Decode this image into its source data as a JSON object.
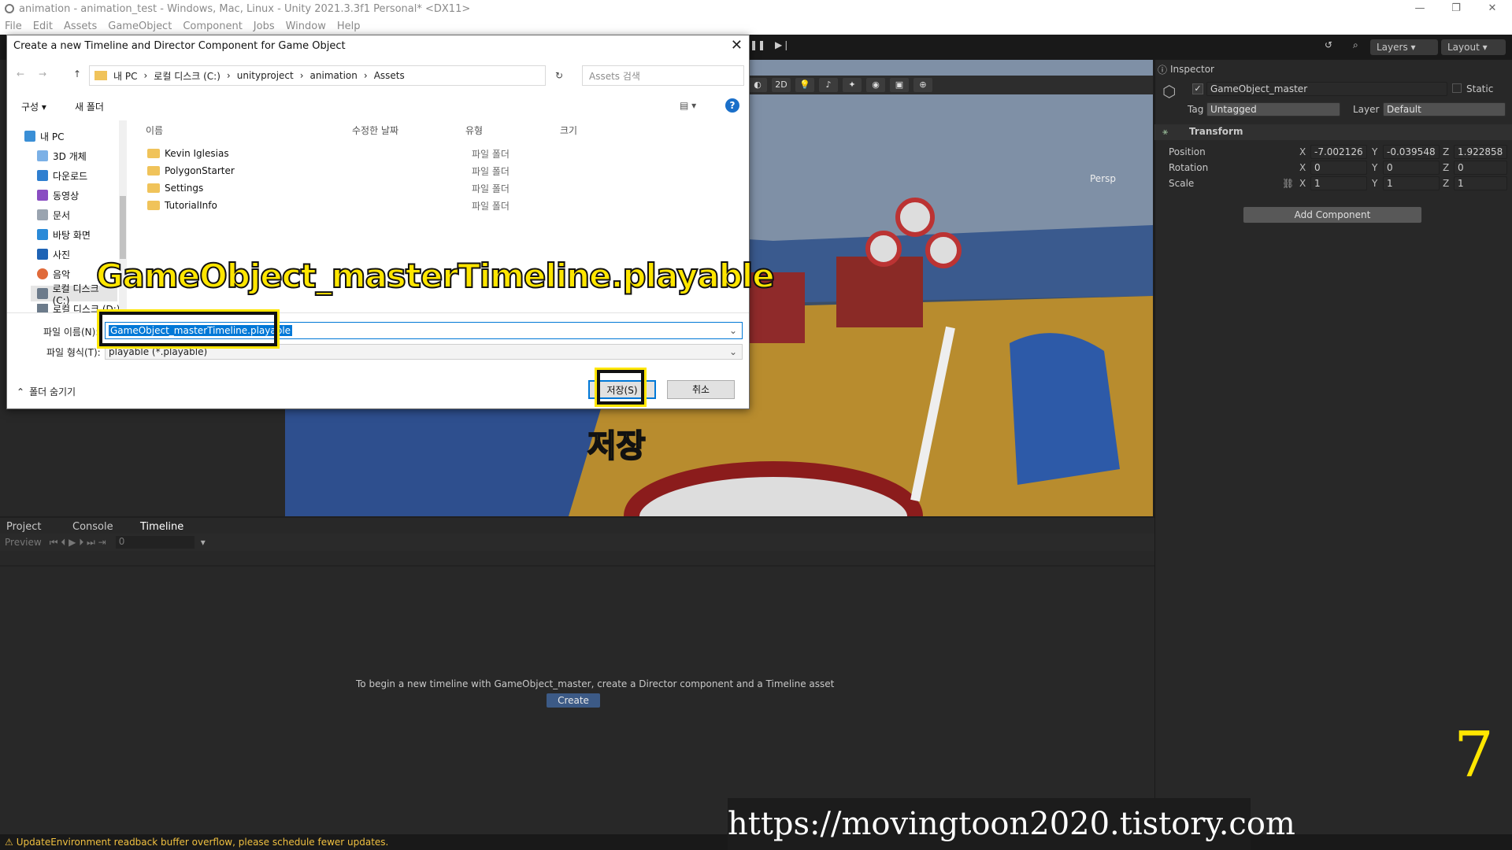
{
  "window": {
    "title": "animation - animation_test - Windows, Mac, Linux - Unity 2021.3.3f1 Personal* <DX11>"
  },
  "menu": [
    "File",
    "Edit",
    "Assets",
    "GameObject",
    "Component",
    "Jobs",
    "Window",
    "Help"
  ],
  "toolbar": {
    "layers": "Layers",
    "layout": "Layout"
  },
  "scene": {
    "mode_2d": "2D",
    "persp": "Persp"
  },
  "inspector": {
    "tab": "Inspector",
    "object_name": "GameObject_master",
    "static_label": "Static",
    "tag_label": "Tag",
    "tag_value": "Untagged",
    "layer_label": "Layer",
    "layer_value": "Default",
    "transform_label": "Transform",
    "position_label": "Position",
    "rotation_label": "Rotation",
    "scale_label": "Scale",
    "position": {
      "x": "-7.002126",
      "y": "-0.039548",
      "z": "1.922858"
    },
    "rotation": {
      "x": "0",
      "y": "0",
      "z": "0"
    },
    "scale": {
      "x": "1",
      "y": "1",
      "z": "1"
    },
    "add_component": "Add Component"
  },
  "bottom": {
    "tabs": [
      "Project",
      "Console",
      "Timeline"
    ],
    "preview": "Preview",
    "frame": "0",
    "message": "To begin a new timeline with GameObject_master, create a Director component and a Timeline asset",
    "create_button": "Create"
  },
  "status": "UpdateEnvironment readback buffer overflow, please schedule fewer updates.",
  "dialog": {
    "title": "Create a new Timeline and Director Component for Game Object",
    "path": [
      "내 PC",
      "로컬 디스크 (C:)",
      "unityproject",
      "animation",
      "Assets"
    ],
    "search_placeholder": "Assets 검색",
    "organize": "구성 ▾",
    "new_folder": "새 폴더",
    "nav": [
      "내 PC",
      "3D 개체",
      "다운로드",
      "동영상",
      "문서",
      "바탕 화면",
      "사진",
      "음악",
      "로컬 디스크 (C:)",
      "로컬 디스크 (D:)"
    ],
    "columns": [
      "이름",
      "수정한 날짜",
      "유형",
      "크기"
    ],
    "files": [
      {
        "name": "Kevin Iglesias",
        "type": "파일 폴더"
      },
      {
        "name": "PolygonStarter",
        "type": "파일 폴더"
      },
      {
        "name": "Settings",
        "type": "파일 폴더"
      },
      {
        "name": "TutorialInfo",
        "type": "파일 폴더"
      }
    ],
    "filename_label": "파일 이름(N):",
    "filename": "GameObject_masterTimeline.playable",
    "filetype_label": "파일 형식(T):",
    "filetype": "playable (*.playable)",
    "hide_folders": "폴더 숨기기",
    "save": "저장(S)",
    "cancel": "취소"
  },
  "annotations": {
    "filename_caption": "GameObject_masterTimeline.playable",
    "save_caption": "저장",
    "step": "7",
    "watermark": "https://movingtoon2020.tistory.com",
    "highlight_color": "#ffe600"
  }
}
